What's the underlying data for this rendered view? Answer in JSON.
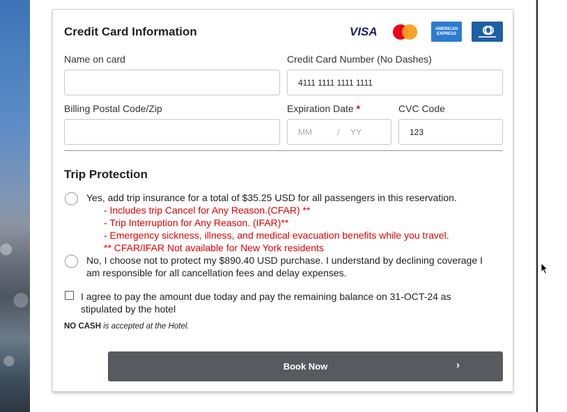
{
  "card": {
    "title": "Credit Card Information",
    "brands": {
      "visa": "VISA",
      "amex": "AMERICAN EXPRESS"
    },
    "name_label": "Name on card",
    "name_value": "",
    "number_label": "Credit Card Number (No Dashes)",
    "number_value": "4111 1111 1111 1111",
    "postal_label": "Billing Postal Code/Zip",
    "postal_value": "",
    "exp_label": "Expiration Date",
    "exp_required": "*",
    "exp_mm_placeholder": "MM",
    "exp_separator": "/",
    "exp_yy_placeholder": "YY",
    "cvc_label": "CVC Code",
    "cvc_value": "123"
  },
  "trip_protection": {
    "title": "Trip Protection",
    "option_yes": "Yes, add trip insurance for a total of $35.25 USD for all passengers in this reservation.",
    "benefits": [
      "- Includes trip Cancel for Any Reason.(CFAR) **",
      "- Trip Interruption for Any Reason. (IFAR)**",
      "- Emergency sickness, illness, and medical evacuation benefits while you travel.",
      "** CFAR/IFAR Not available for New York residents"
    ],
    "option_no_line1": "No, I choose not to protect my $890.40 USD purchase. I understand by declining coverage I",
    "option_no_line2": "am responsible for all cancellation fees and delay expenses."
  },
  "agreement": {
    "text": "I agree to pay the amount due today and pay the remaining balance on 31-OCT-24 as stipulated by the hotel",
    "checked": false
  },
  "payment_note": {
    "bold": "NO CASH",
    "italic": "is accepted at the Hotel."
  },
  "book_button": {
    "label": "Book Now",
    "chevron": "›"
  },
  "colors": {
    "button_bg": "#575a5e",
    "required": "#c8102e",
    "benefits_text": "#e00000"
  }
}
